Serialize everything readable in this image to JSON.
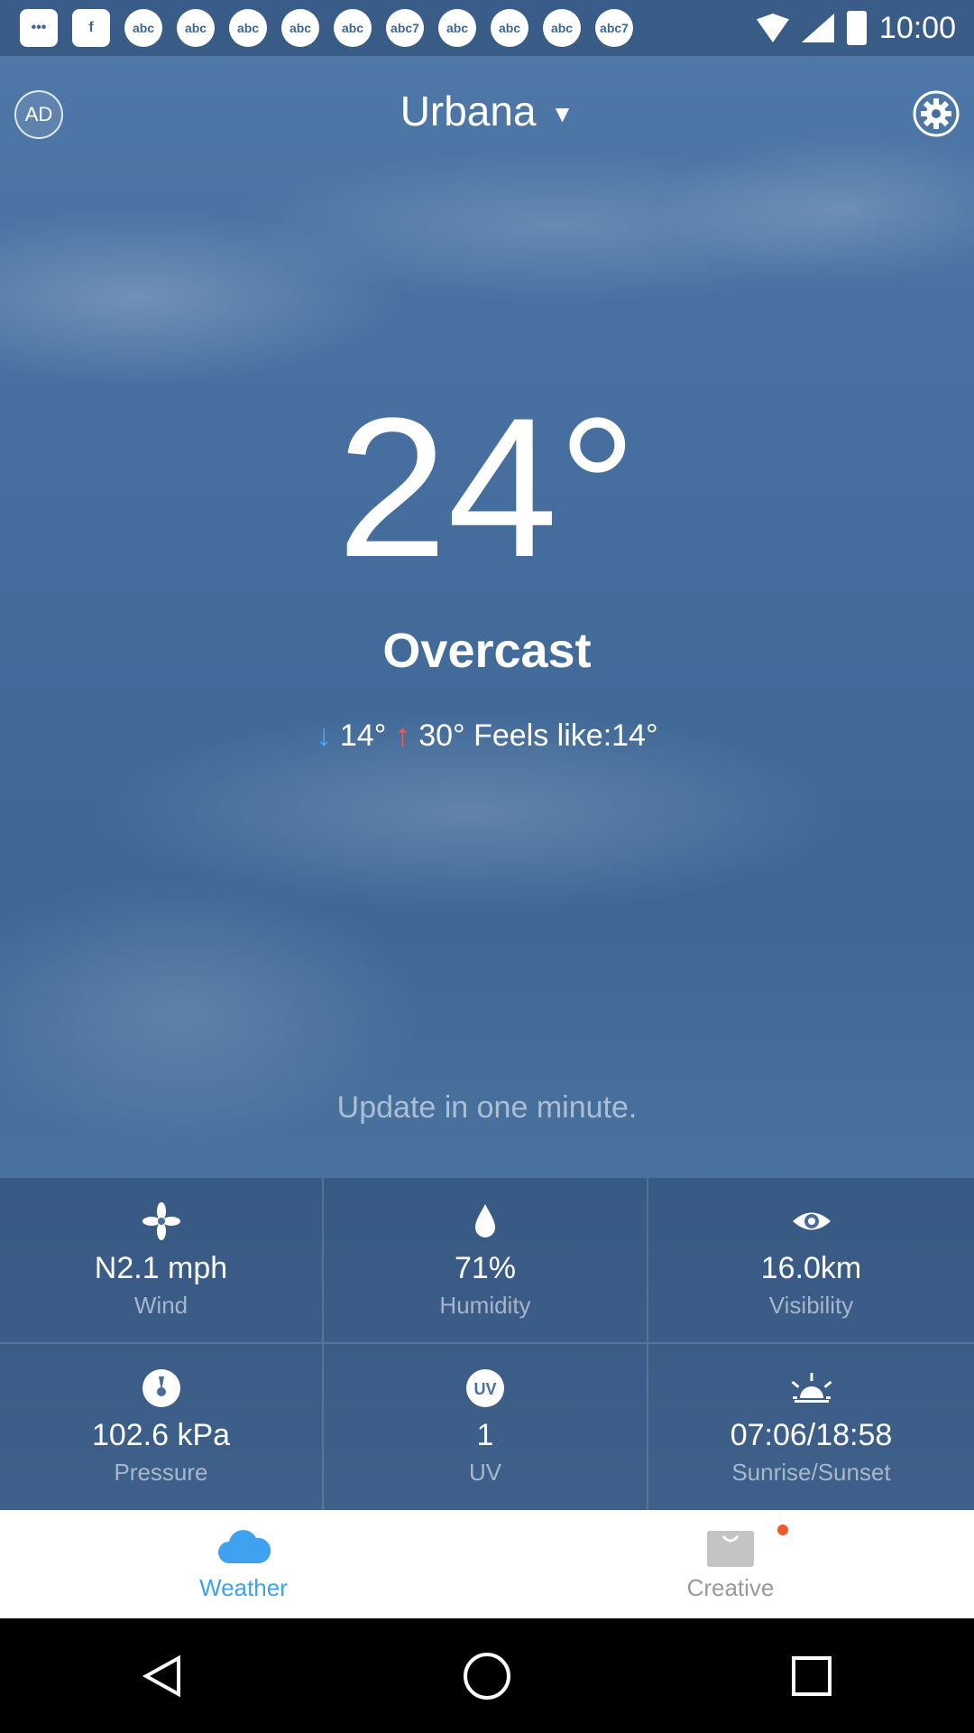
{
  "status_bar": {
    "time": "10:00",
    "notification_icons": [
      "message-icon",
      "facebook-icon",
      "abc-icon",
      "abc-icon",
      "abc-icon",
      "abc-icon",
      "abc-icon",
      "abc7-icon",
      "abc-icon",
      "abc-icon",
      "abc-icon",
      "abc7-icon"
    ]
  },
  "top_bar": {
    "ad_label": "AD",
    "city": "Urbana",
    "city_caret": "▼"
  },
  "current": {
    "temperature": "24°",
    "condition": "Overcast",
    "low_arrow": "↓",
    "low": "14°",
    "high_arrow": "↑",
    "high": "30°",
    "feels_like": "Feels like:14°",
    "update_text": "Update in one minute."
  },
  "details": [
    {
      "icon": "wind-fan-icon",
      "value": "N2.1 mph",
      "label": "Wind"
    },
    {
      "icon": "humidity-drop-icon",
      "value": "71%",
      "label": "Humidity"
    },
    {
      "icon": "visibility-eye-icon",
      "value": "16.0km",
      "label": "Visibility"
    },
    {
      "icon": "pressure-gauge-icon",
      "value": "102.6 kPa",
      "label": "Pressure"
    },
    {
      "icon": "uv-icon",
      "value": "1",
      "label": "UV"
    },
    {
      "icon": "sunrise-icon",
      "value": "07:06/18:58",
      "label": "Sunrise/Sunset"
    }
  ],
  "bottom_nav": {
    "weather_label": "Weather",
    "creative_label": "Creative"
  },
  "colors": {
    "accent": "#3ea2f1",
    "low_arrow": "#4aa7ff",
    "high_arrow": "#ff5a4a",
    "notification_dot": "#f05a2a"
  }
}
